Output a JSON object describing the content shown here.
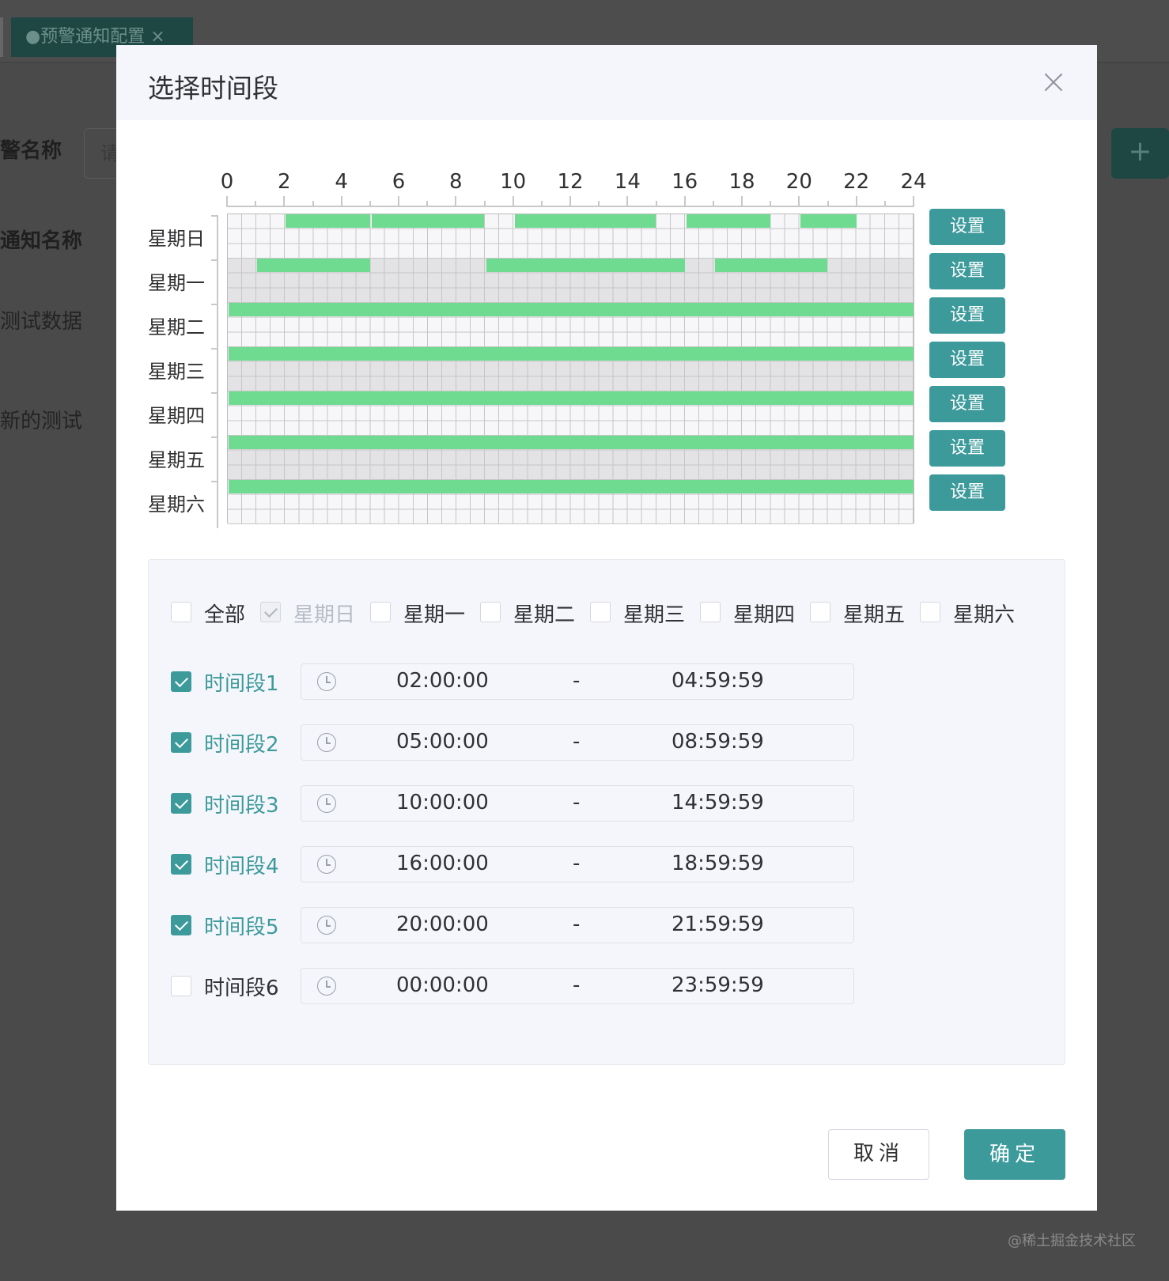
{
  "background": {
    "tab_label": "●预警通知配置 ×",
    "labels": [
      "警名称",
      "通知名称",
      "测试数据",
      "新的测试"
    ],
    "input_placeholder": "请",
    "add_icon": "plus-icon",
    "watermark": "@稀土掘金技术社区"
  },
  "dialog": {
    "title": "选择时间段",
    "close_icon": "close-icon",
    "hour_labels": [
      "0",
      "2",
      "4",
      "6",
      "8",
      "10",
      "12",
      "14",
      "16",
      "18",
      "20",
      "22",
      "24"
    ],
    "days": [
      {
        "label": "星期日",
        "button": "设置",
        "segments": [
          [
            2,
            5
          ],
          [
            5,
            9
          ],
          [
            10,
            15
          ],
          [
            16,
            19
          ],
          [
            20,
            22
          ]
        ]
      },
      {
        "label": "星期一",
        "button": "设置",
        "segments": [
          [
            1,
            5
          ],
          [
            9,
            16
          ],
          [
            17,
            21
          ]
        ]
      },
      {
        "label": "星期二",
        "button": "设置",
        "segments": [
          [
            0,
            24
          ]
        ]
      },
      {
        "label": "星期三",
        "button": "设置",
        "segments": [
          [
            0,
            24
          ]
        ]
      },
      {
        "label": "星期四",
        "button": "设置",
        "segments": [
          [
            0,
            24
          ]
        ]
      },
      {
        "label": "星期五",
        "button": "设置",
        "segments": [
          [
            0,
            24
          ]
        ]
      },
      {
        "label": "星期六",
        "button": "设置",
        "segments": [
          [
            0,
            24
          ]
        ]
      }
    ],
    "day_checkboxes": [
      {
        "label": "全部",
        "checked": false,
        "disabled": false
      },
      {
        "label": "星期日",
        "checked": true,
        "disabled": true
      },
      {
        "label": "星期一",
        "checked": false,
        "disabled": false
      },
      {
        "label": "星期二",
        "checked": false,
        "disabled": false
      },
      {
        "label": "星期三",
        "checked": false,
        "disabled": false
      },
      {
        "label": "星期四",
        "checked": false,
        "disabled": false
      },
      {
        "label": "星期五",
        "checked": false,
        "disabled": false
      },
      {
        "label": "星期六",
        "checked": false,
        "disabled": false
      }
    ],
    "periods": [
      {
        "label": "时间段1",
        "checked": true,
        "start": "02:00:00",
        "sep": "-",
        "end": "04:59:59"
      },
      {
        "label": "时间段2",
        "checked": true,
        "start": "05:00:00",
        "sep": "-",
        "end": "08:59:59"
      },
      {
        "label": "时间段3",
        "checked": true,
        "start": "10:00:00",
        "sep": "-",
        "end": "14:59:59"
      },
      {
        "label": "时间段4",
        "checked": true,
        "start": "16:00:00",
        "sep": "-",
        "end": "18:59:59"
      },
      {
        "label": "时间段5",
        "checked": true,
        "start": "20:00:00",
        "sep": "-",
        "end": "21:59:59"
      },
      {
        "label": "时间段6",
        "checked": false,
        "start": "00:00:00",
        "sep": "-",
        "end": "23:59:59"
      }
    ],
    "cancel_label": "取消",
    "ok_label": "确定"
  },
  "colors": {
    "accent": "#3d9a9b",
    "segment": "#6edb91",
    "overlay": "#4a4a4a"
  }
}
